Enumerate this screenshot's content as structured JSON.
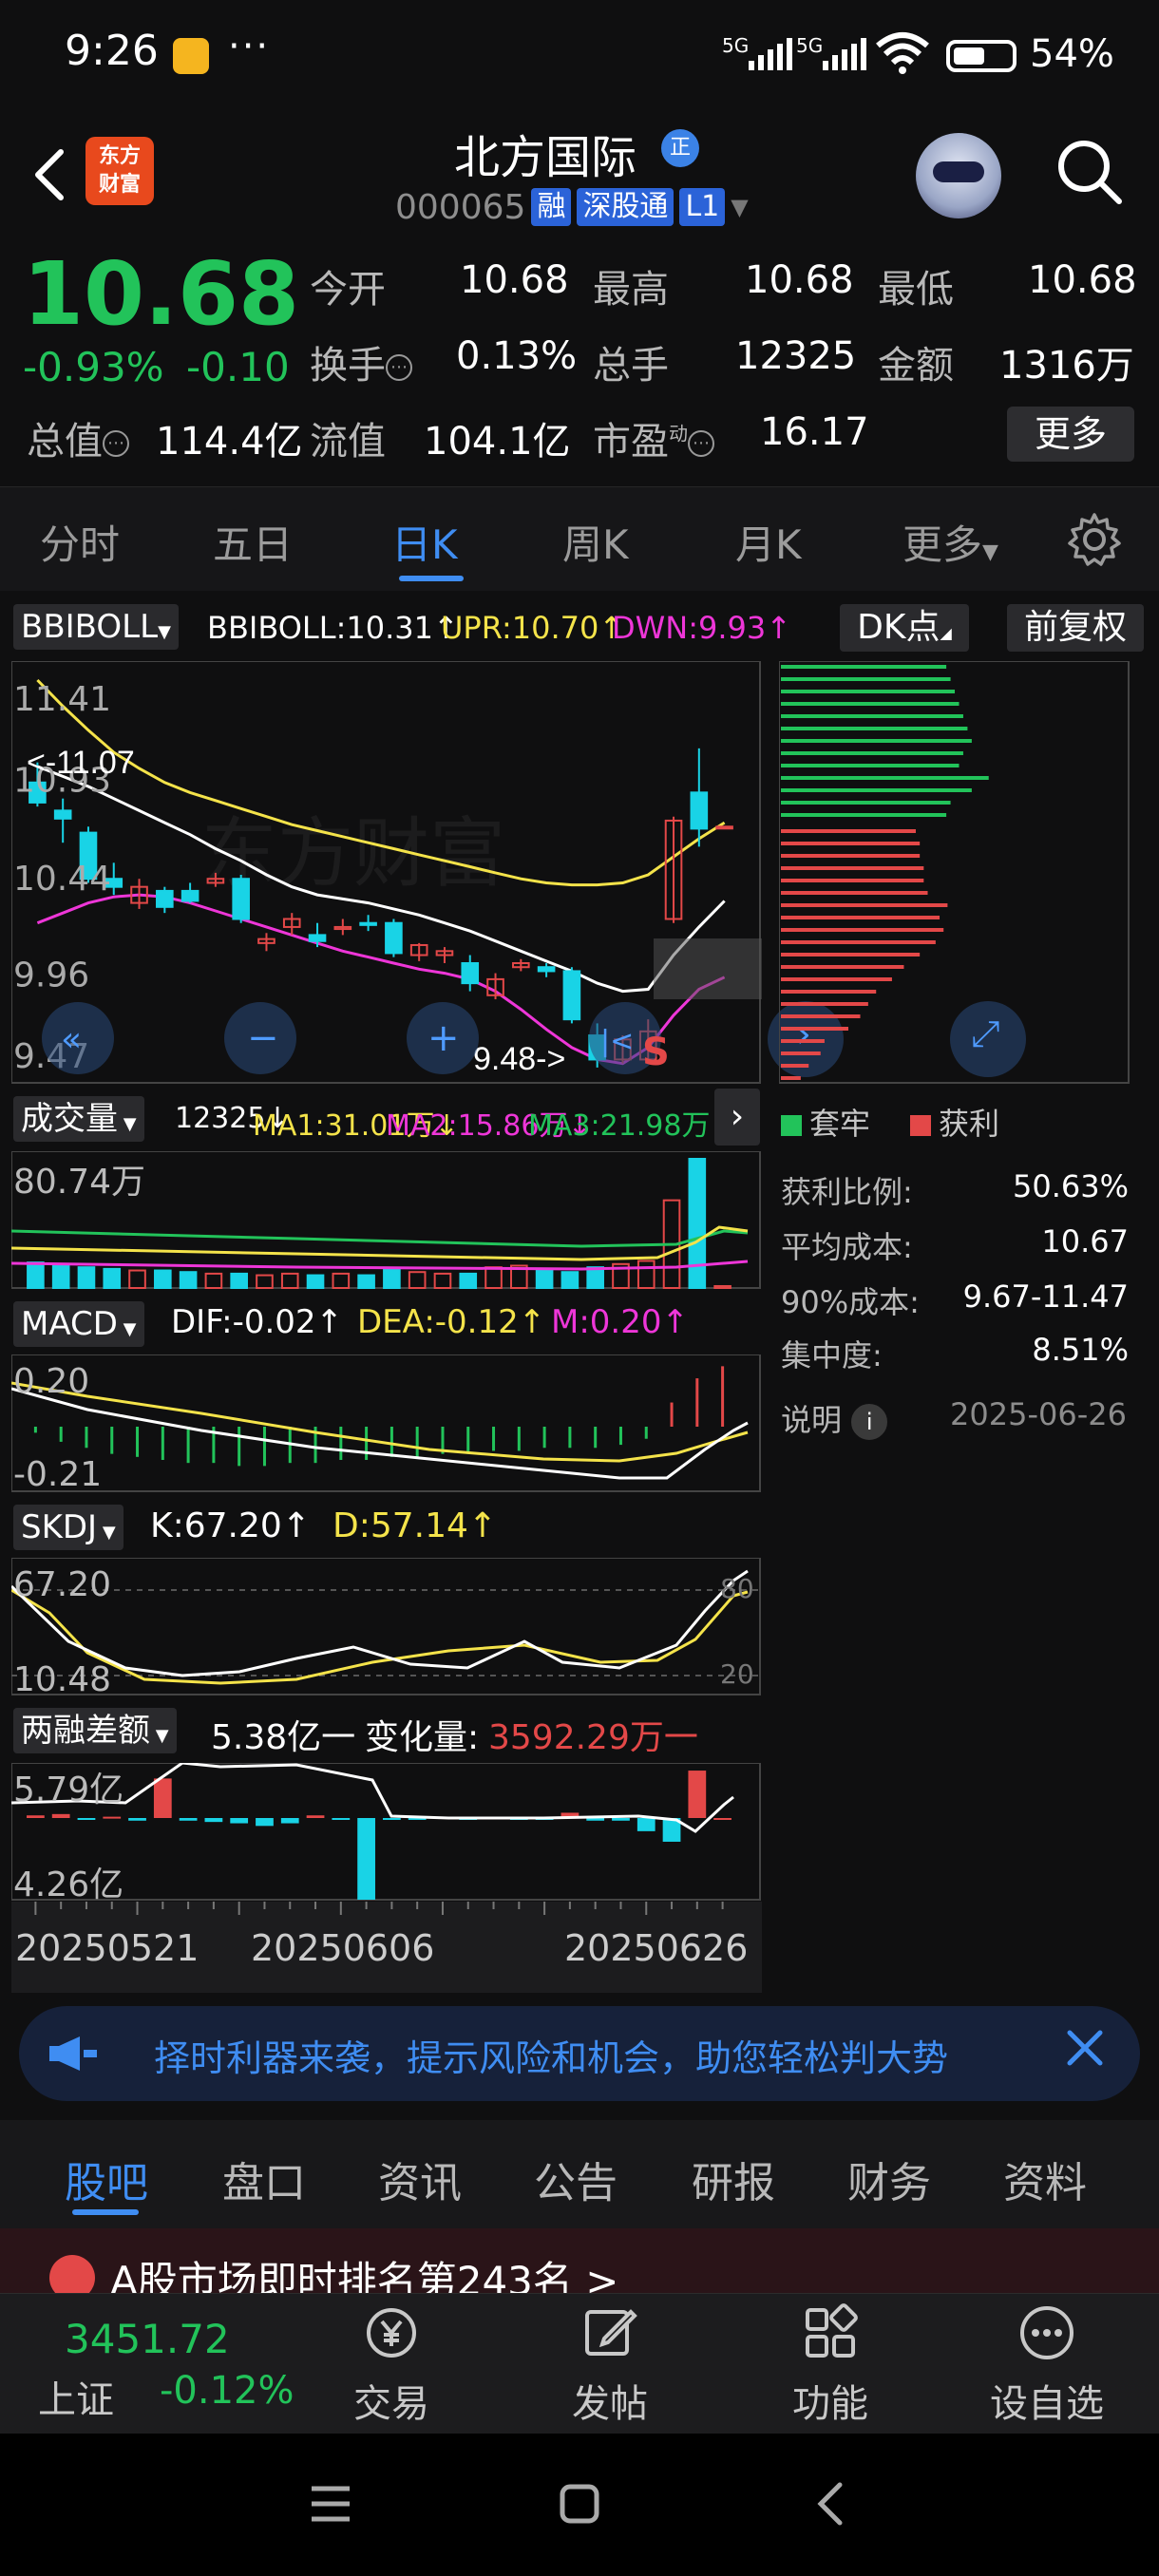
{
  "status_bar": {
    "time": "9:26",
    "more": "···",
    "signal1": "5G",
    "signal2": "5G",
    "battery_pct": "54%"
  },
  "header": {
    "logo_line1": "东方",
    "logo_line2": "财富",
    "stock_name": "北方国际",
    "verify_badge": "正",
    "stock_code": "000065",
    "tag_margin": "融",
    "tag_connect": "深股通",
    "tag_level": "L1"
  },
  "quote": {
    "price": "10.68",
    "change_pct": "-0.93%",
    "change_abs": "-0.10",
    "open_label": "今开",
    "open": "10.68",
    "high_label": "最高",
    "high": "10.68",
    "low_label": "最低",
    "low": "10.68",
    "turnover_label": "换手",
    "turnover": "0.13%",
    "volume_label": "总手",
    "volume": "12325",
    "amount_label": "金额",
    "amount": "1316万",
    "total_cap_label": "总值",
    "total_cap": "114.4亿",
    "float_cap_label": "流值",
    "float_cap": "104.1亿",
    "pe_label": "市盈",
    "pe_sup": "动",
    "pe": "16.17",
    "more_button": "更多"
  },
  "period_tabs": [
    "分时",
    "五日",
    "日K",
    "周K",
    "月K",
    "更多"
  ],
  "period_active": "日K",
  "indicators": {
    "main": {
      "selector": "BBIBOLL",
      "value_text": "BBIBOLL:10.31↑",
      "upr_text": "UPR:10.70↑",
      "dwn_text": "DWN:9.93↑",
      "dk_button": "DK点",
      "fq_button": "前复权",
      "y_labels": [
        "11.41",
        "10.93",
        "10.44",
        "9.96",
        "9.47"
      ],
      "high_marker": "<-11.07",
      "low_marker": "9.48->",
      "watermark": "东方财富",
      "candles": [
        [
          10.9,
          11.0,
          10.78,
          10.8
        ],
        [
          10.76,
          10.82,
          10.6,
          10.72
        ],
        [
          10.65,
          10.68,
          10.4,
          10.42
        ],
        [
          10.42,
          10.5,
          10.34,
          10.38
        ],
        [
          10.3,
          10.42,
          10.27,
          10.38
        ],
        [
          10.36,
          10.38,
          10.25,
          10.28
        ],
        [
          10.36,
          10.4,
          10.3,
          10.31
        ],
        [
          10.4,
          10.45,
          10.38,
          10.42
        ],
        [
          10.42,
          10.44,
          10.2,
          10.22
        ],
        [
          10.1,
          10.15,
          10.06,
          10.12
        ],
        [
          10.18,
          10.25,
          10.14,
          10.22
        ],
        [
          10.14,
          10.2,
          10.08,
          10.11
        ],
        [
          10.17,
          10.22,
          10.14,
          10.18
        ],
        [
          10.2,
          10.24,
          10.16,
          10.19
        ],
        [
          10.2,
          10.22,
          10.03,
          10.05
        ],
        [
          10.04,
          10.1,
          10.01,
          10.09
        ],
        [
          10.04,
          10.08,
          10.0,
          10.06
        ],
        [
          10.0,
          10.04,
          9.86,
          9.9
        ],
        [
          9.84,
          9.95,
          9.82,
          9.92
        ],
        [
          9.98,
          10.02,
          9.96,
          10.0
        ],
        [
          9.98,
          10.0,
          9.93,
          9.96
        ],
        [
          9.96,
          9.98,
          9.7,
          9.72
        ],
        [
          9.64,
          9.7,
          9.48,
          9.52
        ],
        [
          9.52,
          9.64,
          9.5,
          9.62
        ],
        [
          9.52,
          9.72,
          9.5,
          9.66
        ],
        [
          10.22,
          10.73,
          10.2,
          10.71
        ],
        [
          10.85,
          11.07,
          10.58,
          10.67
        ],
        [
          10.68,
          10.68,
          10.68,
          10.68
        ]
      ],
      "bbiboll": [
        10.98,
        10.93,
        10.88,
        10.82,
        10.76,
        10.7,
        10.64,
        10.57,
        10.51,
        10.44,
        10.38,
        10.34,
        10.32,
        10.3,
        10.27,
        10.24,
        10.2,
        10.16,
        10.11,
        10.06,
        10.01,
        9.96,
        9.9,
        9.86,
        9.87,
        10.04,
        10.18,
        10.31
      ],
      "upr": [
        11.41,
        11.28,
        11.16,
        11.05,
        10.97,
        10.9,
        10.85,
        10.81,
        10.77,
        10.73,
        10.69,
        10.66,
        10.63,
        10.6,
        10.57,
        10.54,
        10.51,
        10.48,
        10.45,
        10.42,
        10.4,
        10.39,
        10.39,
        10.4,
        10.44,
        10.53,
        10.62,
        10.7
      ],
      "dwn": [
        10.2,
        10.25,
        10.3,
        10.33,
        10.34,
        10.33,
        10.3,
        10.26,
        10.22,
        10.18,
        10.14,
        10.1,
        10.06,
        10.03,
        10.0,
        9.97,
        9.95,
        9.92,
        9.86,
        9.77,
        9.67,
        9.58,
        9.52,
        9.5,
        9.58,
        9.74,
        9.87,
        9.93
      ]
    },
    "volume": {
      "selector": "成交量",
      "value_text": "12325↓",
      "ma1_text": "MA1:31.01万↓",
      "ma2_text": "MA2:15.86万↓",
      "ma3_text": "MA3:21.98万↓",
      "y_label": "80.74万",
      "values": [
        16,
        15,
        13,
        12,
        11,
        11,
        10,
        9,
        9,
        8,
        9,
        8,
        9,
        8,
        12,
        10,
        9,
        9,
        13,
        14,
        12,
        10,
        13,
        15,
        17,
        55,
        81,
        1.2
      ]
    },
    "macd": {
      "selector": "MACD",
      "dif_text": "DIF:-0.02↑",
      "dea_text": "DEA:-0.12↑",
      "m_text": "M:0.20↑",
      "y_labels": [
        "0.20",
        "-0.21"
      ]
    },
    "skdj": {
      "selector": "SKDJ",
      "k_text": "K:67.20↑",
      "d_text": "D:57.14↑",
      "y_labels": [
        "67.20",
        "10.48"
      ],
      "ref_labels": [
        "80",
        "20"
      ]
    },
    "margin": {
      "selector": "两融差额",
      "value_text": "5.38亿一",
      "change_label": "变化量:",
      "change_value": "3592.29万一",
      "y_labels": [
        "5.79亿",
        "4.26亿"
      ]
    },
    "x_dates": [
      "20250521",
      "20250606",
      "20250626"
    ]
  },
  "chip": {
    "legend_trapped": "套牢",
    "legend_profit": "获利",
    "profit_ratio_label": "获利比例:",
    "profit_ratio": "50.63%",
    "avg_cost_label": "平均成本:",
    "avg_cost": "10.67",
    "cost90_label": "90%成本:",
    "cost90": "9.67-11.47",
    "concentration_label": "集中度:",
    "concentration": "8.51%",
    "note_label": "说明",
    "date": "2025-06-26"
  },
  "ad": {
    "text": "择时利器来袭，提示风险和机会，助您轻松判大势"
  },
  "lower_tabs": [
    "股吧",
    "盘口",
    "资讯",
    "公告",
    "研报",
    "财务",
    "资料"
  ],
  "lower_active": "股吧",
  "peek_text": "A股市场即时排名第243名 >",
  "bottom_nav": {
    "index_price": "3451.72",
    "index_name": "上证",
    "index_change": "-0.12%",
    "items": [
      "交易",
      "发帖",
      "功能",
      "设自选"
    ]
  },
  "colors": {
    "up": "#e34848",
    "down": "#22c35a",
    "accent": "#3f8df2",
    "candle_down": "#19d3e6",
    "bbiboll": "#ffffff",
    "upr": "#f4e34a",
    "dwn": "#ee36d8"
  }
}
